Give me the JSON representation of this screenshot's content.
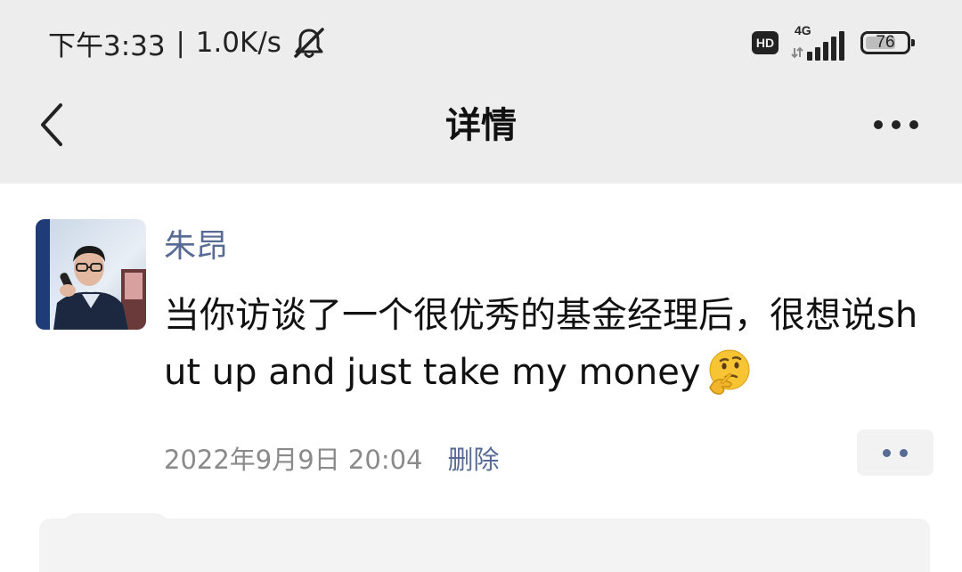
{
  "status_bar": {
    "time": "下午3:33",
    "separator": "|",
    "net_speed": "1.0K/s",
    "mute_icon": "bell-muted-icon",
    "hd_badge": "HD",
    "network_type": "4G",
    "signal_icon": "signal-bars-icon",
    "battery_level": 76,
    "battery_text": "76"
  },
  "nav": {
    "back_icon": "chevron-left-icon",
    "title": "详情",
    "more_icon": "more-horizontal-icon"
  },
  "post": {
    "author": "朱昂",
    "text": "当你访谈了一个很优秀的基金经理后，很想说shut up and just take my money",
    "emoji": "thinking-face-emoji",
    "timestamp": "2022年9月9日 20:04",
    "delete_label": "删除",
    "comment_icon": "more-dots-icon"
  },
  "colors": {
    "background_bar": "#ededed",
    "link_blue": "#576b95",
    "meta_gray": "#8a8a8a",
    "text_primary": "#111111"
  }
}
